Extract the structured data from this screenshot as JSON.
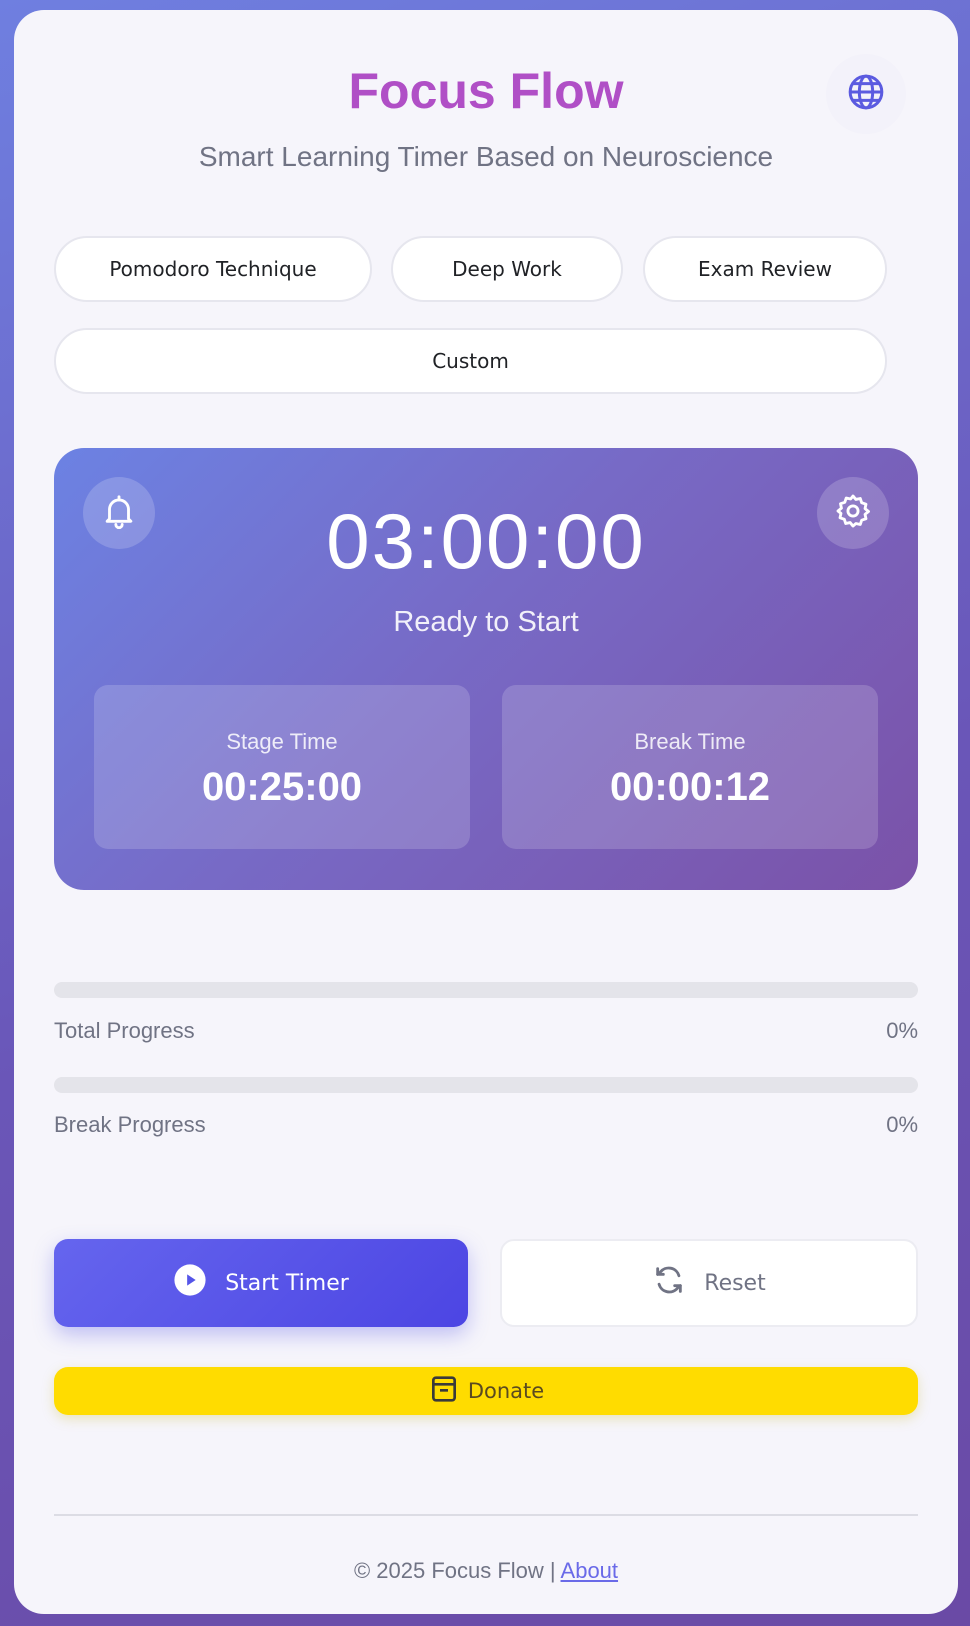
{
  "header": {
    "title": "Focus Flow",
    "subtitle": "Smart Learning Timer Based on Neuroscience",
    "language_icon": "globe-icon"
  },
  "modes": [
    {
      "label": "Pomodoro Technique"
    },
    {
      "label": "Deep Work"
    },
    {
      "label": "Exam Review"
    },
    {
      "label": "Custom"
    }
  ],
  "timer": {
    "clock": "03:00:00",
    "status": "Ready to Start",
    "bell_icon": "bell-icon",
    "settings_icon": "gear-icon",
    "stage": {
      "label": "Stage Time",
      "value": "00:25:00"
    },
    "break": {
      "label": "Break Time",
      "value": "00:00:12"
    }
  },
  "progress": {
    "total": {
      "label": "Total Progress",
      "percent_text": "0%",
      "fraction": 0
    },
    "break": {
      "label": "Break Progress",
      "percent_text": "0%",
      "fraction": 0
    }
  },
  "controls": {
    "start_label": "Start Timer",
    "start_icon": "play-icon",
    "reset_label": "Reset",
    "reset_icon": "refresh-icon",
    "donate_label": "Donate",
    "donate_icon": "archive-icon"
  },
  "footer": {
    "copyright": "© 2025 Focus Flow | ",
    "about_link": "About"
  },
  "colors": {
    "title": "#b04fc6",
    "accent": "#6a6ae8",
    "donate": "#ffdc00"
  }
}
